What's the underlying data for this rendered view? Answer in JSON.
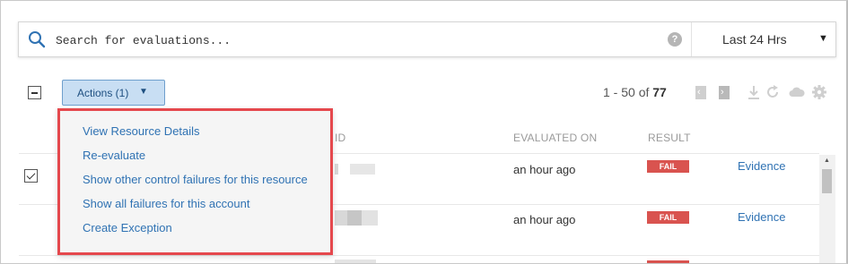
{
  "search": {
    "placeholder": "Search for evaluations...",
    "help_icon": "help-icon",
    "time_range": "Last 24 Hrs"
  },
  "toolbar": {
    "actions_label": "Actions (1)",
    "paging_prefix": "1 - 50 of",
    "paging_total": "77",
    "icons": [
      "prev-page-icon",
      "next-page-icon",
      "download-icon",
      "refresh-icon",
      "cloud-icon",
      "gear-icon"
    ]
  },
  "menu": {
    "items": [
      "View Resource Details",
      "Re-evaluate",
      "Show other control failures for this resource",
      "Show all failures for this account",
      "Create Exception"
    ]
  },
  "table": {
    "headers": {
      "id": "ID",
      "evaluated_on": "EVALUATED ON",
      "result": "RESULT"
    },
    "rows": [
      {
        "checked": true,
        "evaluated_on": "an hour ago",
        "result": "FAIL",
        "link": "Evidence"
      },
      {
        "checked": false,
        "evaluated_on": "an hour ago",
        "result": "FAIL",
        "link": "Evidence"
      }
    ]
  },
  "colors": {
    "accent": "#2f72b3",
    "fail": "#d9534f",
    "highlight_border": "#e5484d",
    "actions_bg": "#c8def3"
  }
}
